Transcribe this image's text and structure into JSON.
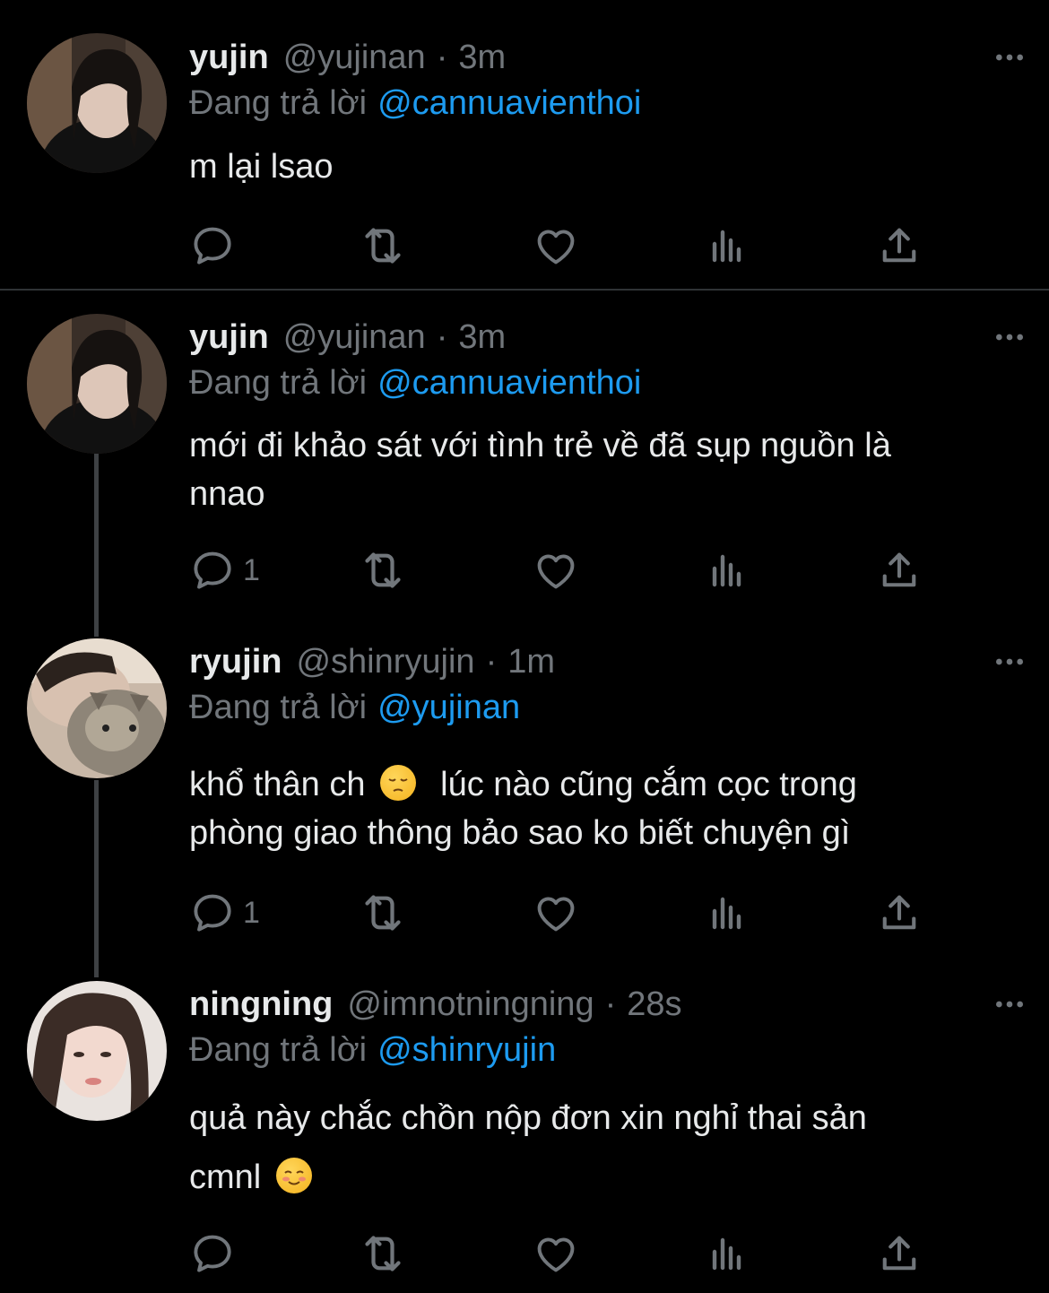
{
  "colors": {
    "background": "#000000",
    "text": "#e7e9ea",
    "secondary": "#71767b",
    "link": "#1d9bf0",
    "divider": "#2f3336",
    "thread_line": "#3e4144"
  },
  "tweets": [
    {
      "name": "yujin",
      "handle": "@yujinan",
      "separator": "·",
      "time": "3m",
      "replying_label": "Đang trả lời",
      "replying_to": "@cannuavienthoi",
      "text_lines": [
        "m lại lsao"
      ],
      "reply_count": "",
      "icons": [
        "reply-icon",
        "retweet-icon",
        "like-icon",
        "analytics-icon",
        "share-icon"
      ]
    },
    {
      "name": "yujin",
      "handle": "@yujinan",
      "separator": "·",
      "time": "3m",
      "replying_label": "Đang trả lời",
      "replying_to": "@cannuavienthoi",
      "text_lines": [
        "mới đi khảo sát với tình trẻ về đã sụp nguồn là",
        "nnao"
      ],
      "reply_count": "1",
      "icons": [
        "reply-icon",
        "retweet-icon",
        "like-icon",
        "analytics-icon",
        "share-icon"
      ]
    },
    {
      "name": "ryujin",
      "handle": "@shinryujin",
      "separator": "·",
      "time": "1m",
      "replying_label": "Đang trả lời",
      "replying_to": "@yujinan",
      "text_lines": [
        "khổ thân ch",
        "lúc nào cũng cắm cọc trong",
        "phòng giao thông bảo sao ko biết chuyện gì"
      ],
      "emoji": "pensive-face-emoji",
      "reply_count": "1",
      "icons": [
        "reply-icon",
        "retweet-icon",
        "like-icon",
        "analytics-icon",
        "share-icon"
      ]
    },
    {
      "name": "ningning",
      "handle": "@imnotningning",
      "separator": "·",
      "time": "28s",
      "replying_label": "Đang trả lời",
      "replying_to": "@shinryujin",
      "text_lines": [
        "quả này chắc chồn nộp đơn xin nghỉ thai sản",
        "cmnl"
      ],
      "emoji": "smiling-face-emoji",
      "reply_count": "",
      "icons": [
        "reply-icon",
        "retweet-icon",
        "like-icon",
        "analytics-icon",
        "share-icon"
      ]
    }
  ]
}
